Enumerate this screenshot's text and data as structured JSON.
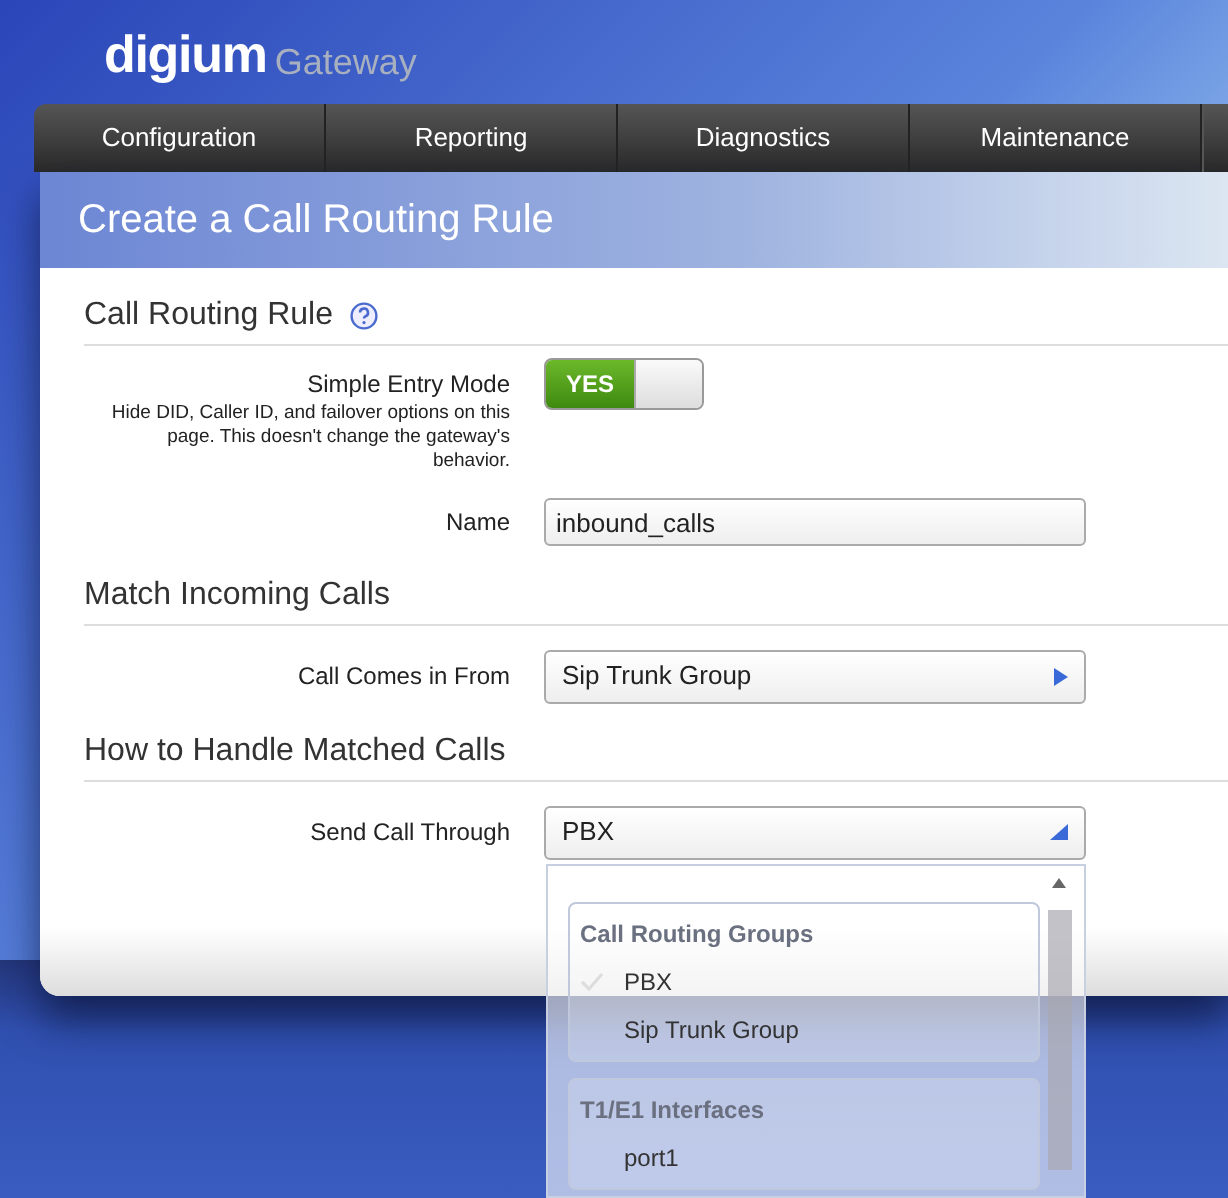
{
  "logo": {
    "brand": "digium",
    "product": "Gateway"
  },
  "nav": [
    {
      "label": "Configuration",
      "selected": false
    },
    {
      "label": "Reporting",
      "selected": false
    },
    {
      "label": "Diagnostics",
      "selected": false
    },
    {
      "label": "Maintenance",
      "selected": false
    }
  ],
  "page_title": "Create a Call Routing Rule",
  "sections": [
    {
      "heading": "Call Routing Rule",
      "help": true,
      "fields": [
        {
          "kind": "toggle",
          "label": "Simple Entry Mode",
          "hint": "Hide DID, Caller ID, and failover options on this page. This doesn't change the gateway's behavior.",
          "on": true,
          "on_text": "YES"
        },
        {
          "kind": "text",
          "label": "Name",
          "value": "inbound_calls"
        }
      ]
    },
    {
      "heading": "Match Incoming Calls",
      "help": false,
      "fields": [
        {
          "kind": "select",
          "label": "Call Comes in From",
          "value": "Sip Trunk Group",
          "expanded": false
        }
      ]
    },
    {
      "heading": "How to Handle Matched Calls",
      "help": false,
      "fields": [
        {
          "kind": "select",
          "label": "Send Call Through",
          "value": "PBX",
          "expanded": true
        }
      ]
    }
  ],
  "dropdown": {
    "groups": [
      {
        "title": "Call Routing Groups",
        "options": [
          {
            "label": "PBX",
            "selected": true
          },
          {
            "label": "Sip Trunk Group",
            "selected": false
          }
        ]
      },
      {
        "title": "T1/E1 Interfaces",
        "options": [
          {
            "label": "port1",
            "selected": false
          }
        ]
      }
    ]
  }
}
